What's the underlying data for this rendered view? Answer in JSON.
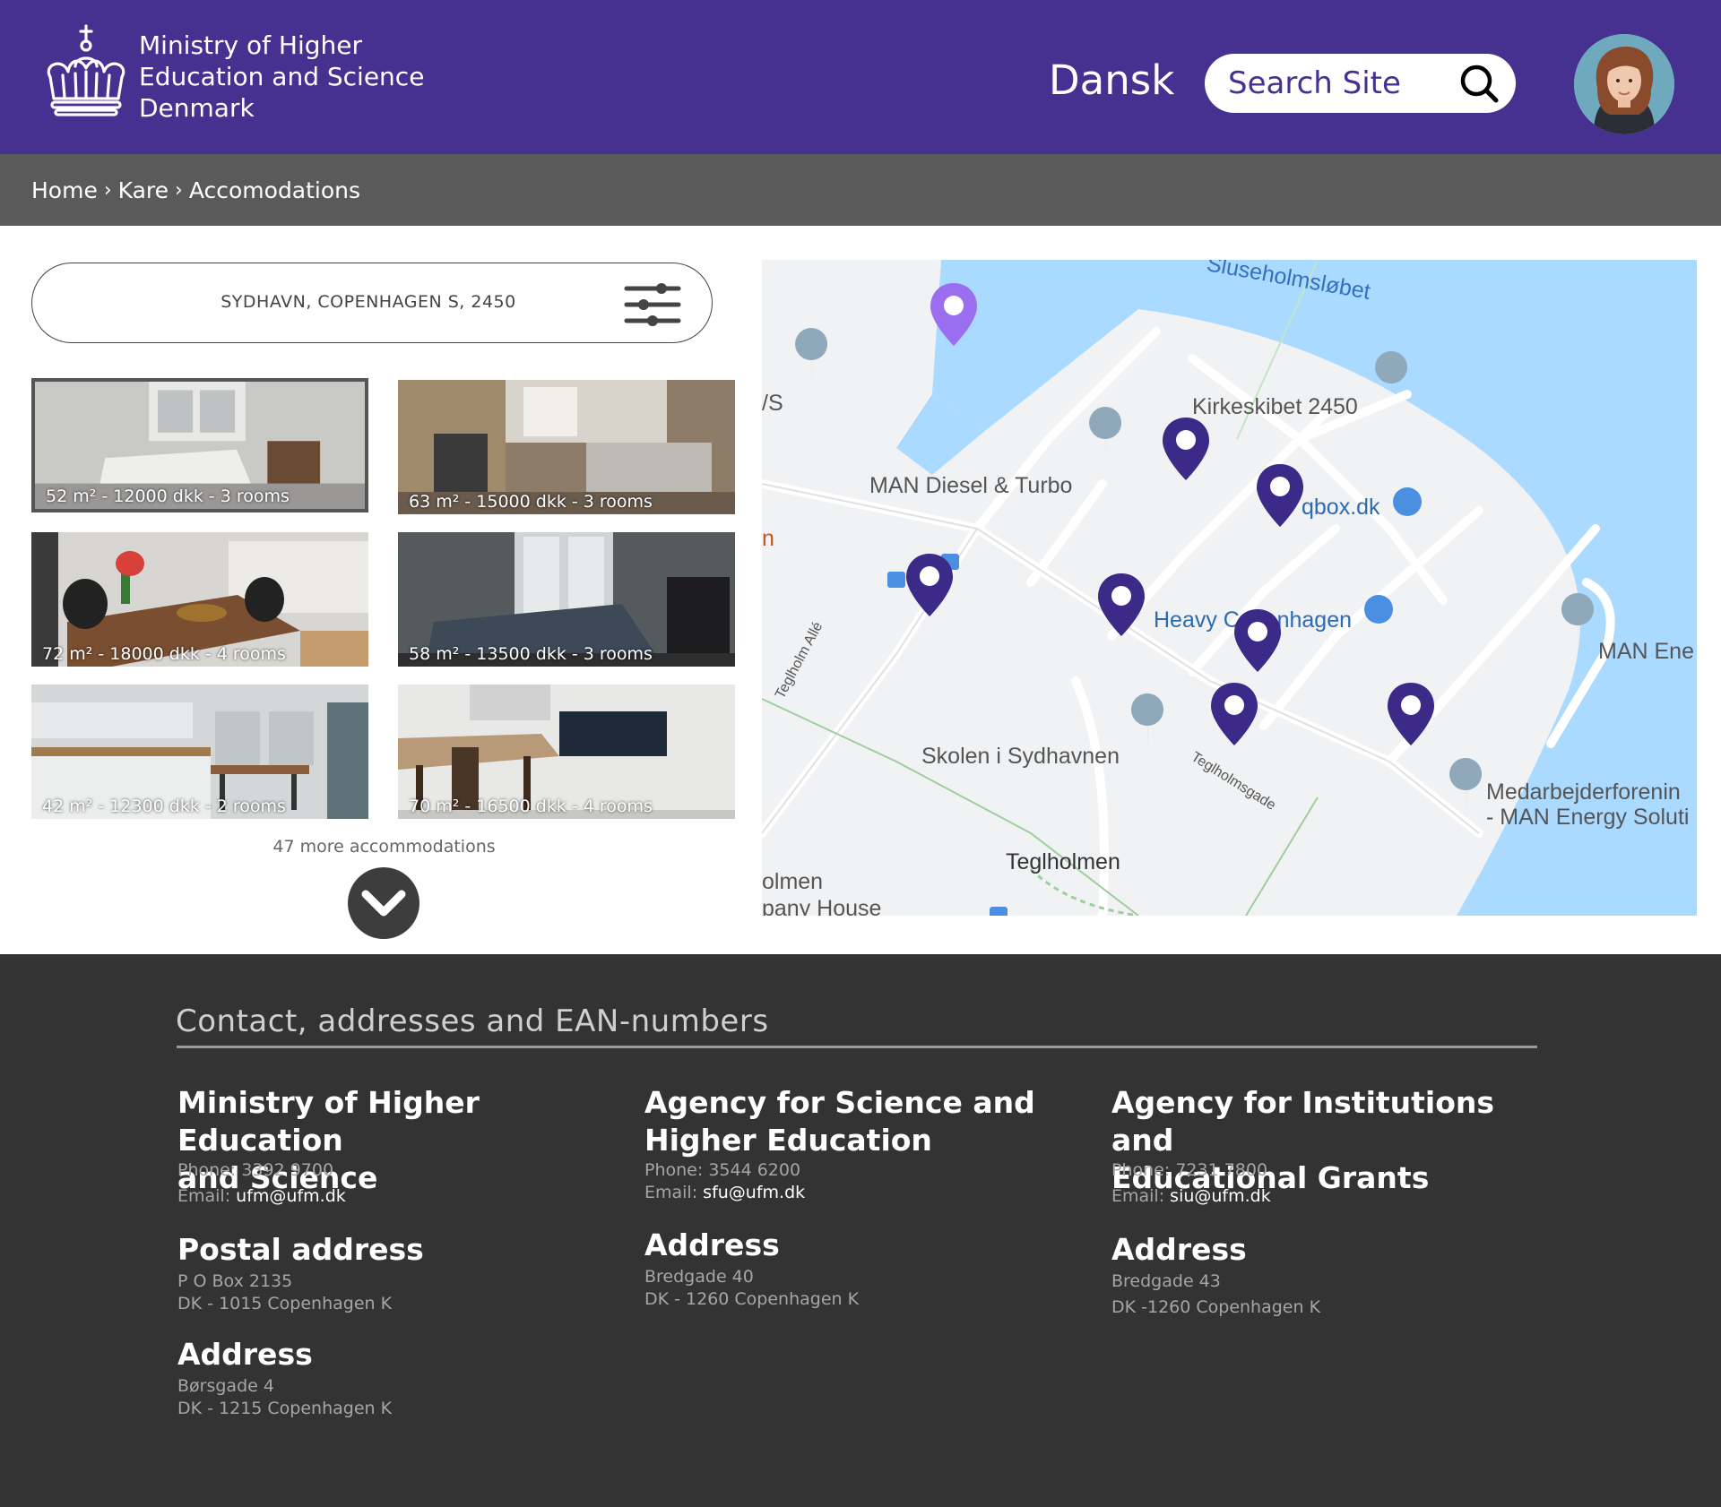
{
  "header": {
    "logo_icon": "crown-icon",
    "ministry_lines": [
      "Ministry of Higher",
      "Education and Science",
      "Denmark"
    ],
    "language": "Dansk",
    "search_placeholder": "Search Site",
    "search_icon": "search-icon",
    "avatar_icon": "user-avatar"
  },
  "breadcrumb": {
    "items": [
      "Home",
      "Kare",
      "Accomodations"
    ],
    "separator": "›"
  },
  "search": {
    "location": "SYDHAVN, COPENHAGEN S, 2450",
    "filter_icon": "sliders-icon"
  },
  "listings": [
    {
      "caption": "52 m² - 12000 dkk - 3 rooms",
      "selected": true
    },
    {
      "caption": "63 m² - 15000 dkk - 3 rooms",
      "selected": false
    },
    {
      "caption": "72 m² - 18000 dkk - 4 rooms",
      "selected": false
    },
    {
      "caption": "58 m² - 13500 dkk - 3 rooms",
      "selected": false
    },
    {
      "caption": "42 m² - 12300 dkk - 2 rooms",
      "selected": false
    },
    {
      "caption": "70 m² - 16500 dkk - 4 rooms",
      "selected": false
    }
  ],
  "more": {
    "text": "47 more accommodations",
    "icon": "chevron-down-icon"
  },
  "map": {
    "labels": {
      "waterway": "Sluseholmsløbet",
      "kirkeskibet": "Kirkeskibet 2450",
      "man_diesel": "MAN Diesel & Turbo",
      "qbox": "qbox.dk",
      "heavy_copenhagen": "Heavy Copenhagen",
      "man_energy": "MAN Ene",
      "skolen": "Skolen i Sydhavnen",
      "teglholmsgade": "Teglholmsgade",
      "teglholm_alle": "Teglholm Allé",
      "teglholmen": "Teglholmen",
      "medarbejder_line1": "Medarbejderforenin",
      "medarbejder_line2": "- MAN Energy Soluti",
      "edge_vs": "/S",
      "edge_n": "n",
      "edge_olmen": "olmen",
      "edge_pany": "pany House"
    },
    "pin_color": "#3b2a88",
    "highlight_pin_color": "#9b6ef0",
    "water_color": "#aadaff"
  },
  "footer": {
    "title": "Contact, addresses and EAN-numbers",
    "columns": [
      {
        "org_lines": [
          "Ministry of Higher Education",
          "and Science"
        ],
        "phone_label": "Phone:",
        "phone": "3392 9700",
        "email_label": "Email:",
        "email": "ufm@ufm.dk",
        "sections": [
          {
            "heading": "Postal address",
            "lines": [
              "P O Box 2135",
              "DK - 1015 Copenhagen K"
            ]
          },
          {
            "heading": "Address",
            "lines": [
              "Børsgade 4",
              "DK - 1215 Copenhagen K"
            ]
          }
        ]
      },
      {
        "org_lines": [
          "Agency for Science and",
          "Higher Education"
        ],
        "phone_label": "Phone:",
        "phone": "3544 6200",
        "email_label": "Email:",
        "email": "sfu@ufm.dk",
        "sections": [
          {
            "heading": "Address",
            "lines": [
              "Bredgade 40",
              "DK - 1260 Copenhagen K"
            ]
          }
        ]
      },
      {
        "org_lines": [
          "Agency for Institutions and",
          "Educational Grants"
        ],
        "phone_label": "Phone:",
        "phone": "7231 7800",
        "email_label": "Email:",
        "email": "siu@ufm.dk",
        "sections": [
          {
            "heading": "Address",
            "lines": [
              "Bredgade 43",
              "DK -1260 Copenhagen K"
            ]
          }
        ]
      }
    ]
  }
}
